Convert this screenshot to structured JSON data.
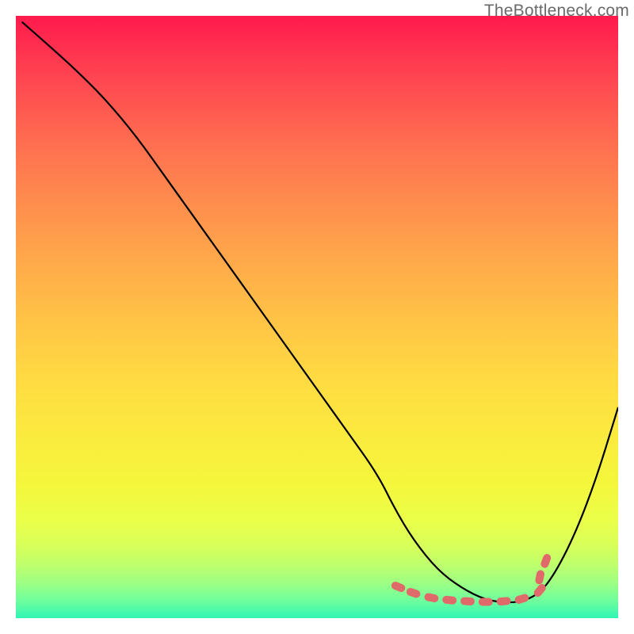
{
  "watermark": "TheBottleneck.com",
  "chart_data": {
    "type": "line",
    "title": "",
    "xlabel": "",
    "ylabel": "",
    "xlim": [
      0,
      100
    ],
    "ylim": [
      0,
      100
    ],
    "grid": false,
    "series": [
      {
        "name": "curve",
        "color": "#000000",
        "x": [
          1,
          5,
          10,
          15,
          20,
          25,
          30,
          35,
          40,
          45,
          50,
          55,
          60,
          63,
          66,
          70,
          74,
          78,
          82,
          85,
          88,
          92,
          96,
          100
        ],
        "y": [
          99,
          95.5,
          91,
          86,
          80,
          73,
          66,
          59,
          52,
          45,
          38,
          31,
          24,
          18,
          13,
          8,
          5,
          3,
          2.5,
          3,
          5,
          12,
          22,
          35
        ]
      }
    ],
    "markers": {
      "name": "optimal-band",
      "color": "#e06a6a",
      "shape": "rounded-dash",
      "x": [
        63.5,
        66,
        69,
        72,
        75,
        78,
        81,
        84,
        87,
        87,
        88
      ],
      "y": [
        5.2,
        4.2,
        3.4,
        3.0,
        2.8,
        2.7,
        2.8,
        3.2,
        4.6,
        6.8,
        9.5
      ]
    }
  },
  "colors": {
    "curve": "#000000",
    "marker": "#e06a6a",
    "watermark": "#6a6a6a"
  }
}
